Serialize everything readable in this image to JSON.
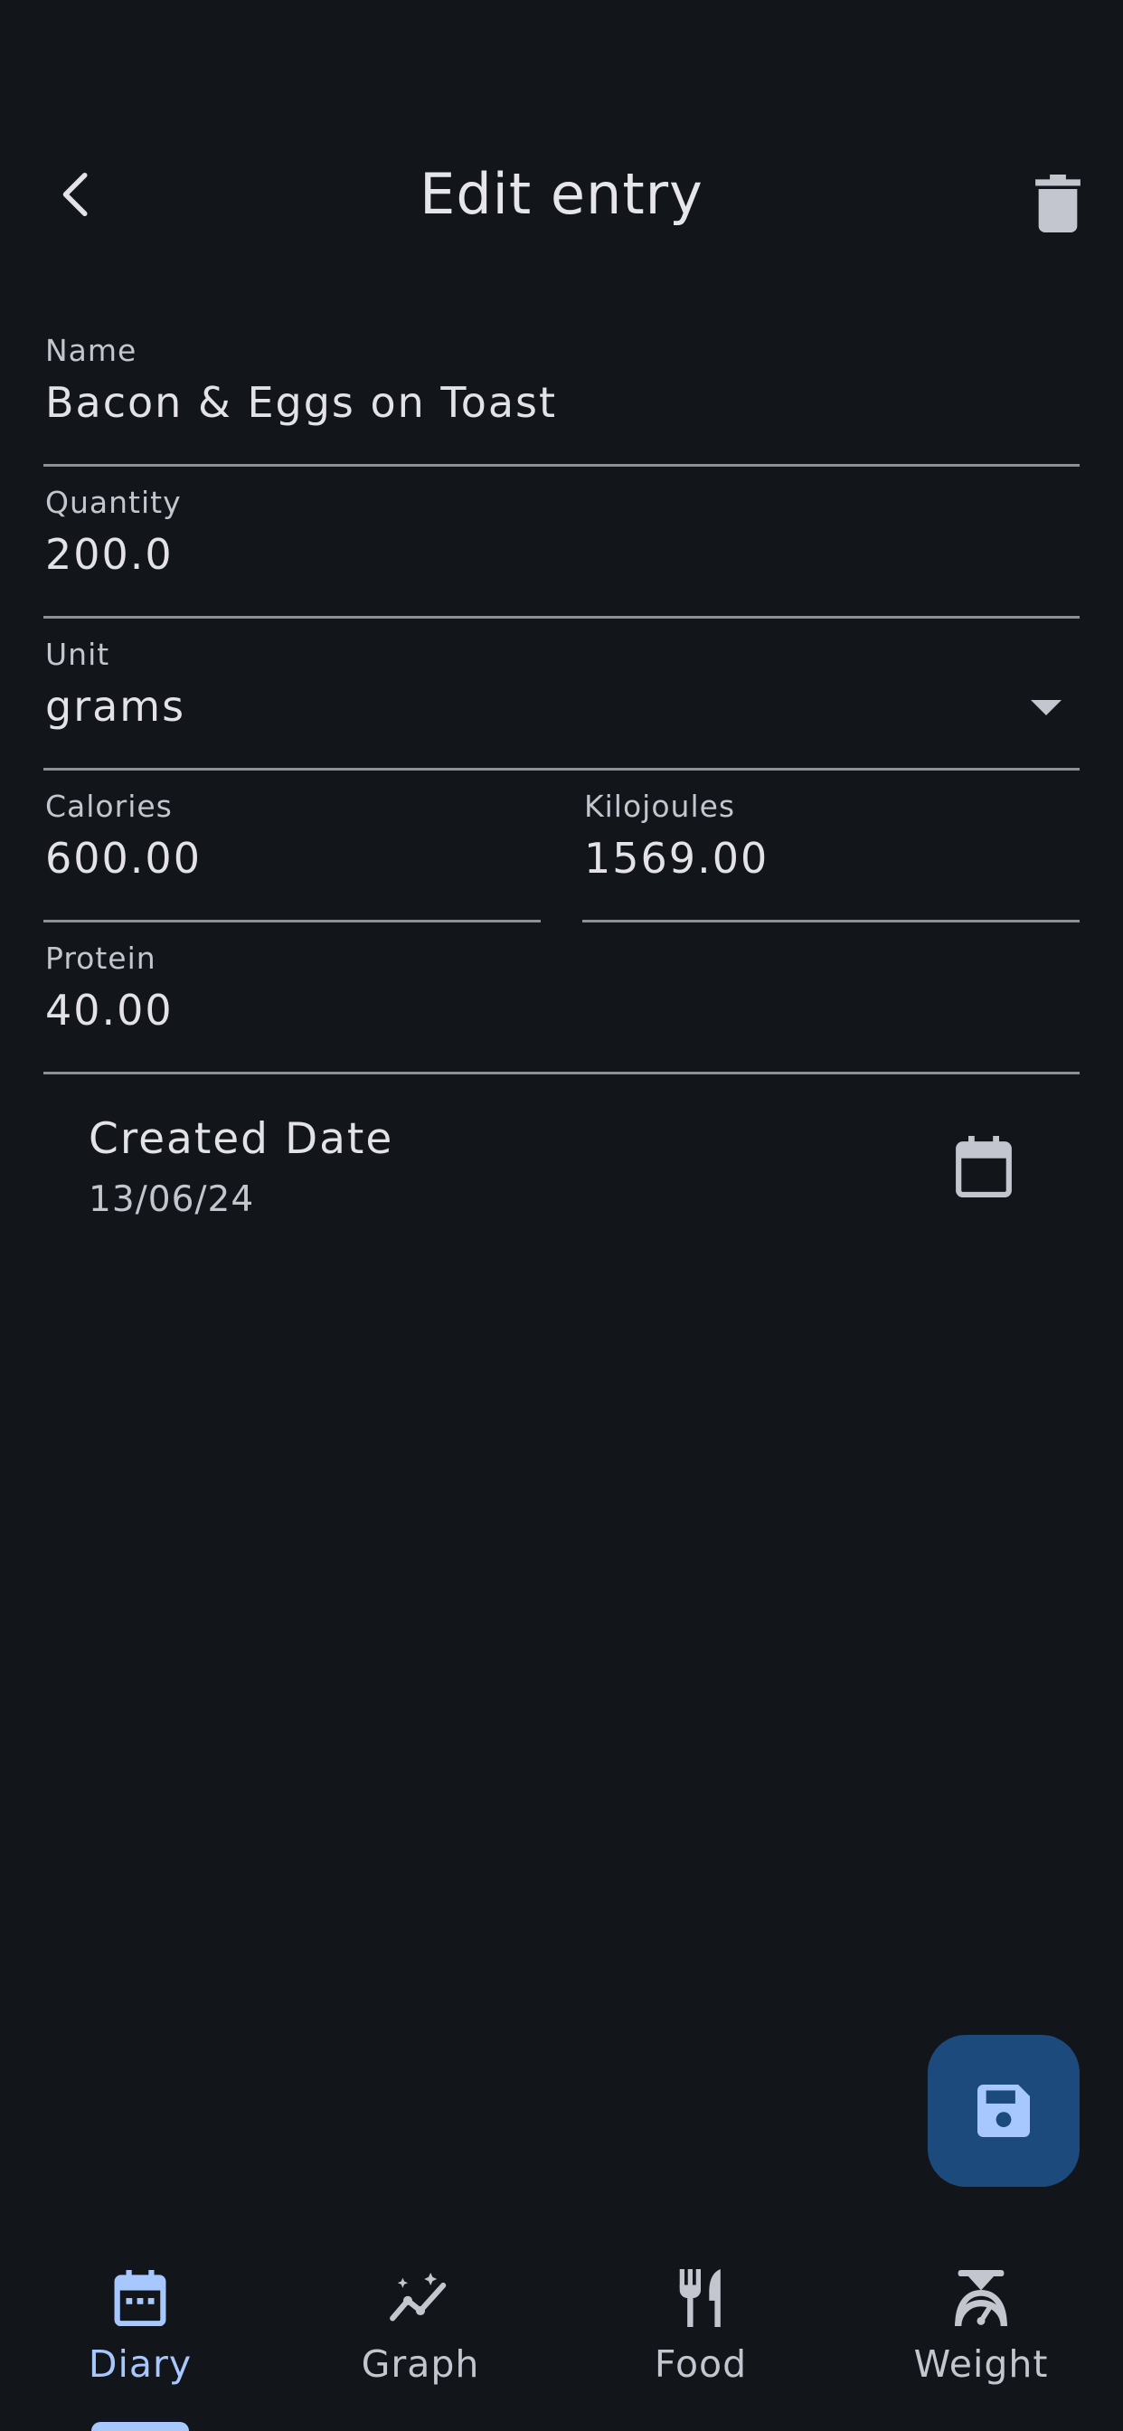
{
  "app_bar": {
    "title": "Edit entry",
    "back_icon": "chevron-left-icon",
    "delete_icon": "trash-icon"
  },
  "form": {
    "name": {
      "label": "Name",
      "value": "Bacon & Eggs on Toast"
    },
    "quantity": {
      "label": "Quantity",
      "value": "200.0"
    },
    "unit": {
      "label": "Unit",
      "value": "grams"
    },
    "calories": {
      "label": "Calories",
      "value": "600.00"
    },
    "kilojoules": {
      "label": "Kilojoules",
      "value": "1569.00"
    },
    "protein": {
      "label": "Protein",
      "value": "40.00"
    }
  },
  "created_date": {
    "title": "Created Date",
    "value": "13/06/24",
    "icon": "calendar-icon"
  },
  "fab": {
    "icon": "save-icon"
  },
  "bottom_nav": {
    "items": [
      {
        "label": "Diary",
        "icon": "diary-calendar-icon",
        "active": true
      },
      {
        "label": "Graph",
        "icon": "graph-icon",
        "active": false
      },
      {
        "label": "Food",
        "icon": "fork-knife-icon",
        "active": false
      },
      {
        "label": "Weight",
        "icon": "scale-icon",
        "active": false
      }
    ]
  },
  "colors": {
    "background": "#12151a",
    "accent": "#a6c8ff",
    "fab_background": "#1d4a7c",
    "divider": "#8d9199",
    "text_primary": "#e3e2e6",
    "text_secondary": "#c4c6cf"
  }
}
